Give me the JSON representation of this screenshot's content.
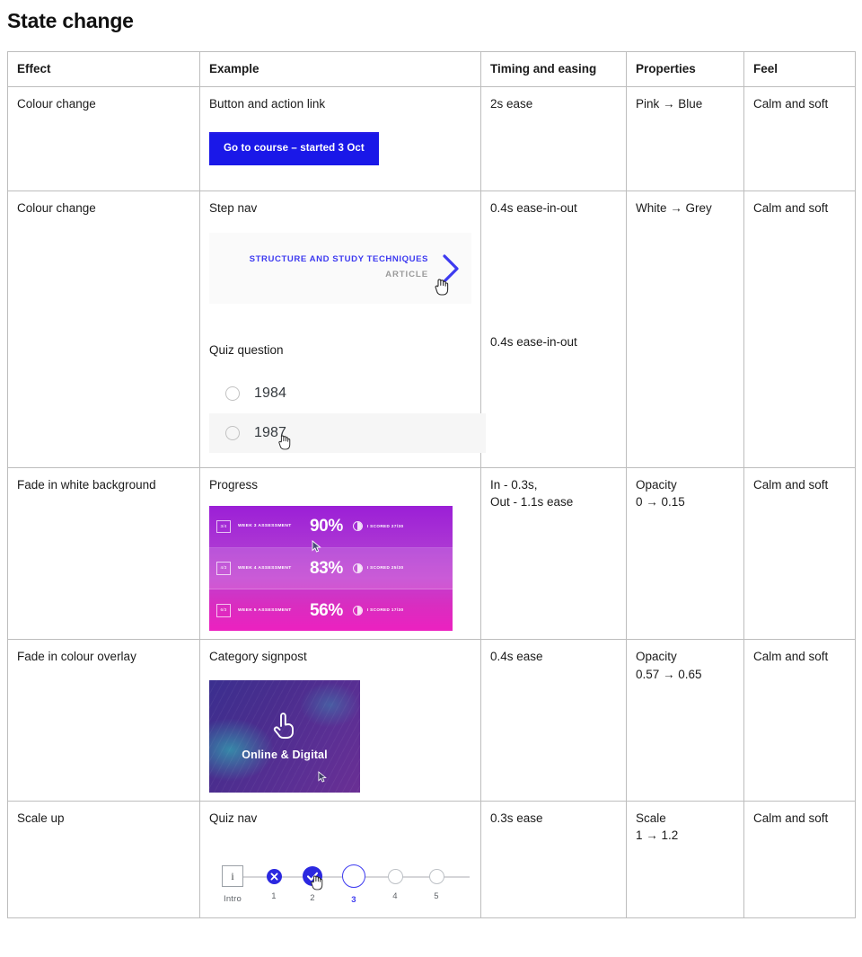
{
  "page": {
    "title": "State change"
  },
  "table": {
    "headers": [
      "Effect",
      "Example",
      "Timing and easing",
      "Properties",
      "Feel"
    ],
    "rows": [
      {
        "effect": "Colour change",
        "example_label": "Button and action link",
        "timing": "2s ease",
        "properties": "Pink → Blue",
        "feel": "Calm and soft",
        "cta_label": "Go to course – started 3 Oct"
      },
      {
        "effect": "Colour change",
        "example_label": "Step nav",
        "example_label2": "Quiz question",
        "timing": "0.4s ease-in-out",
        "timing2": "0.4s ease-in-out",
        "properties": "White → Grey",
        "feel": "Calm and soft",
        "stepnav": {
          "title": "STRUCTURE AND STUDY TECHNIQUES",
          "subtitle": "ARTICLE",
          "chevron": "chevron-right-icon"
        },
        "quiz_options": [
          {
            "label": "1984",
            "hovered": false
          },
          {
            "label": "1987",
            "hovered": true
          }
        ]
      },
      {
        "effect": "Fade in white background",
        "example_label": "Progress",
        "timing_line1": "In - 0.3s,",
        "timing_line2": "Out - 1.1s ease",
        "properties_line1": "Opacity",
        "properties_line2": "0 → 0.15",
        "feel": "Calm and soft",
        "progress_rows": [
          {
            "badge": "3/4",
            "name": "WEEK 3 ASSESSMENT",
            "percent": "90%",
            "score": "I SCORED 27/30",
            "lightened": false
          },
          {
            "badge": "4/3",
            "name": "WEEK 4 ASSESSMENT",
            "percent": "83%",
            "score": "I SCORED 25/30",
            "lightened": true
          },
          {
            "badge": "6/3",
            "name": "WEEK 5 ASSESSMENT",
            "percent": "56%",
            "score": "I SCORED 17/30",
            "lightened": false
          }
        ]
      },
      {
        "effect": "Fade in colour overlay",
        "example_label": "Category signpost",
        "timing": "0.4s ease",
        "properties_line1": "Opacity",
        "properties_line2": "0.57 → 0.65",
        "feel": "Calm and soft",
        "signpost": {
          "caption": "Online & Digital",
          "icon": "tap-gesture-icon"
        }
      },
      {
        "effect": "Scale up",
        "example_label": "Quiz nav",
        "timing": "0.3s ease",
        "properties_line1": "Scale",
        "properties_line2": "1 → 1.2",
        "feel": "Calm and soft",
        "quiz_nav": {
          "intro_glyph": "i",
          "steps": [
            {
              "label": "Intro",
              "state": "intro"
            },
            {
              "label": "1",
              "state": "incorrect"
            },
            {
              "label": "2",
              "state": "correct-hovered"
            },
            {
              "label": "3",
              "state": "current"
            },
            {
              "label": "4",
              "state": "upcoming"
            },
            {
              "label": "5",
              "state": "upcoming"
            }
          ]
        }
      }
    ]
  },
  "colors": {
    "cta_blue": "#1a18e8",
    "link_blue": "#3d3af0",
    "progress_purple": "#9b1fd6",
    "progress_pink": "#ec21c0",
    "border_grey": "#bdbdbd",
    "hover_grey": "#f6f6f6"
  }
}
